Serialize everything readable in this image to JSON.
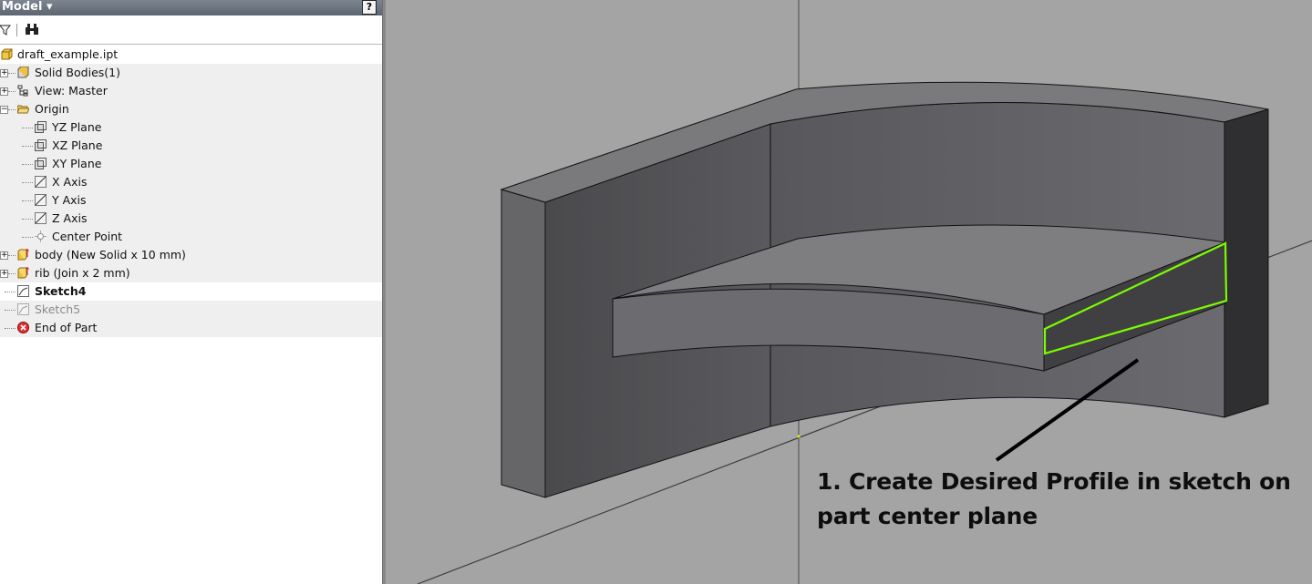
{
  "browser": {
    "title": "Model",
    "help_glyph": "?",
    "toolbar": {
      "filter_icon": "filter-icon",
      "find_icon": "binoculars-icon"
    },
    "tree": [
      {
        "label": "draft_example.ipt",
        "icon": "part-icon"
      },
      {
        "label": "Solid Bodies(1)",
        "icon": "solid-bodies-icon"
      },
      {
        "label": "View: Master",
        "icon": "view-icon"
      },
      {
        "label": "Origin",
        "icon": "folder-icon"
      },
      {
        "label": "YZ Plane",
        "icon": "plane-icon"
      },
      {
        "label": "XZ Plane",
        "icon": "plane-icon"
      },
      {
        "label": "XY Plane",
        "icon": "plane-icon"
      },
      {
        "label": "X Axis",
        "icon": "axis-icon"
      },
      {
        "label": "Y Axis",
        "icon": "axis-icon"
      },
      {
        "label": "Z Axis",
        "icon": "axis-icon"
      },
      {
        "label": "Center Point",
        "icon": "point-icon"
      },
      {
        "label": "body (New Solid x 10 mm)",
        "icon": "extrude-icon"
      },
      {
        "label": "rib (Join x 2 mm)",
        "icon": "extrude-icon"
      },
      {
        "label": "Sketch4",
        "icon": "sketch-icon"
      },
      {
        "label": "Sketch5",
        "icon": "sketch-icon"
      },
      {
        "label": "End of Part",
        "icon": "end-of-part-icon"
      }
    ]
  },
  "viewport": {
    "annotation_line1": "1. Create Desired Profile in sketch on",
    "annotation_line2": "part center plane"
  },
  "colors": {
    "sketch_profile": "#7CFC00",
    "viewport_bg": "#a4a4a4",
    "part_front": "#535356",
    "part_top": "#7a7a7c"
  }
}
